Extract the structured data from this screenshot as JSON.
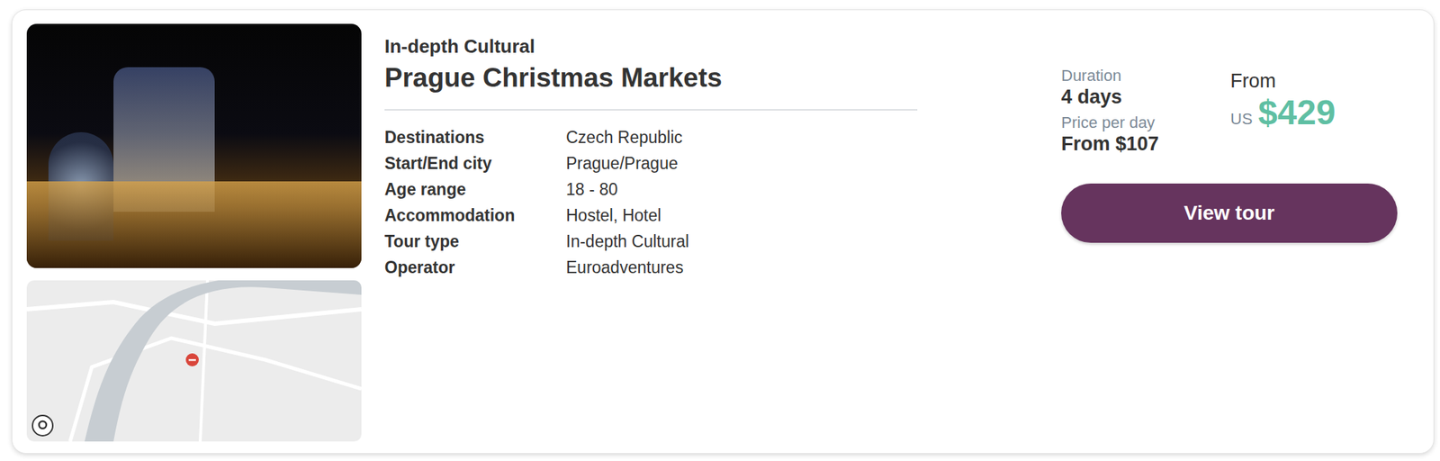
{
  "tour": {
    "category": "In-depth Cultural",
    "title": "Prague Christmas Markets",
    "details": [
      {
        "label": "Destinations",
        "value": "Czech Republic"
      },
      {
        "label": "Start/End city",
        "value": "Prague/Prague"
      },
      {
        "label": "Age range",
        "value": "18 - 80"
      },
      {
        "label": "Accommodation",
        "value": "Hostel, Hotel"
      },
      {
        "label": "Tour type",
        "value": "In-depth Cultural"
      },
      {
        "label": "Operator",
        "value": "Euroadventures"
      }
    ]
  },
  "pricing": {
    "duration_label": "Duration",
    "duration": "4 days",
    "price_per_day_label": "Price per day",
    "price_per_day": "From $107",
    "from_label": "From",
    "currency": "US",
    "price": "$429"
  },
  "buttons": [
    "View tour"
  ]
}
